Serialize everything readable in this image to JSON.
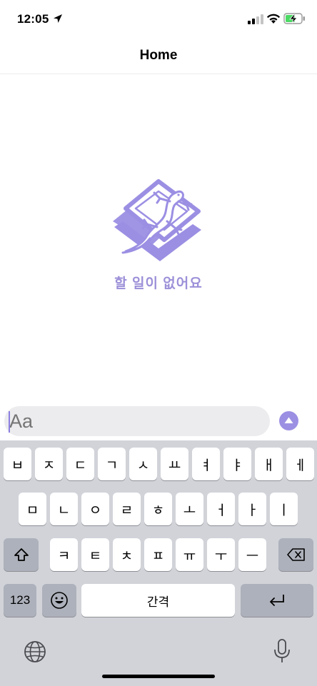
{
  "status": {
    "time": "12:05"
  },
  "nav": {
    "title": "Home"
  },
  "empty_state": {
    "message": "할 일이 없어요"
  },
  "composer": {
    "placeholder": "Aa"
  },
  "keyboard": {
    "row1": [
      "ㅂ",
      "ㅈ",
      "ㄷ",
      "ㄱ",
      "ㅅ",
      "ㅛ",
      "ㅕ",
      "ㅑ",
      "ㅐ",
      "ㅔ"
    ],
    "row2": [
      "ㅁ",
      "ㄴ",
      "ㅇ",
      "ㄹ",
      "ㅎ",
      "ㅗ",
      "ㅓ",
      "ㅏ",
      "ㅣ"
    ],
    "row3": [
      "ㅋ",
      "ㅌ",
      "ㅊ",
      "ㅍ",
      "ㅠ",
      "ㅜ",
      "ㅡ"
    ],
    "numbers_label": "123",
    "space_label": "간격"
  },
  "colors": {
    "accent": "#9b8fe3",
    "keyboard_bg": "#d1d3d9"
  }
}
